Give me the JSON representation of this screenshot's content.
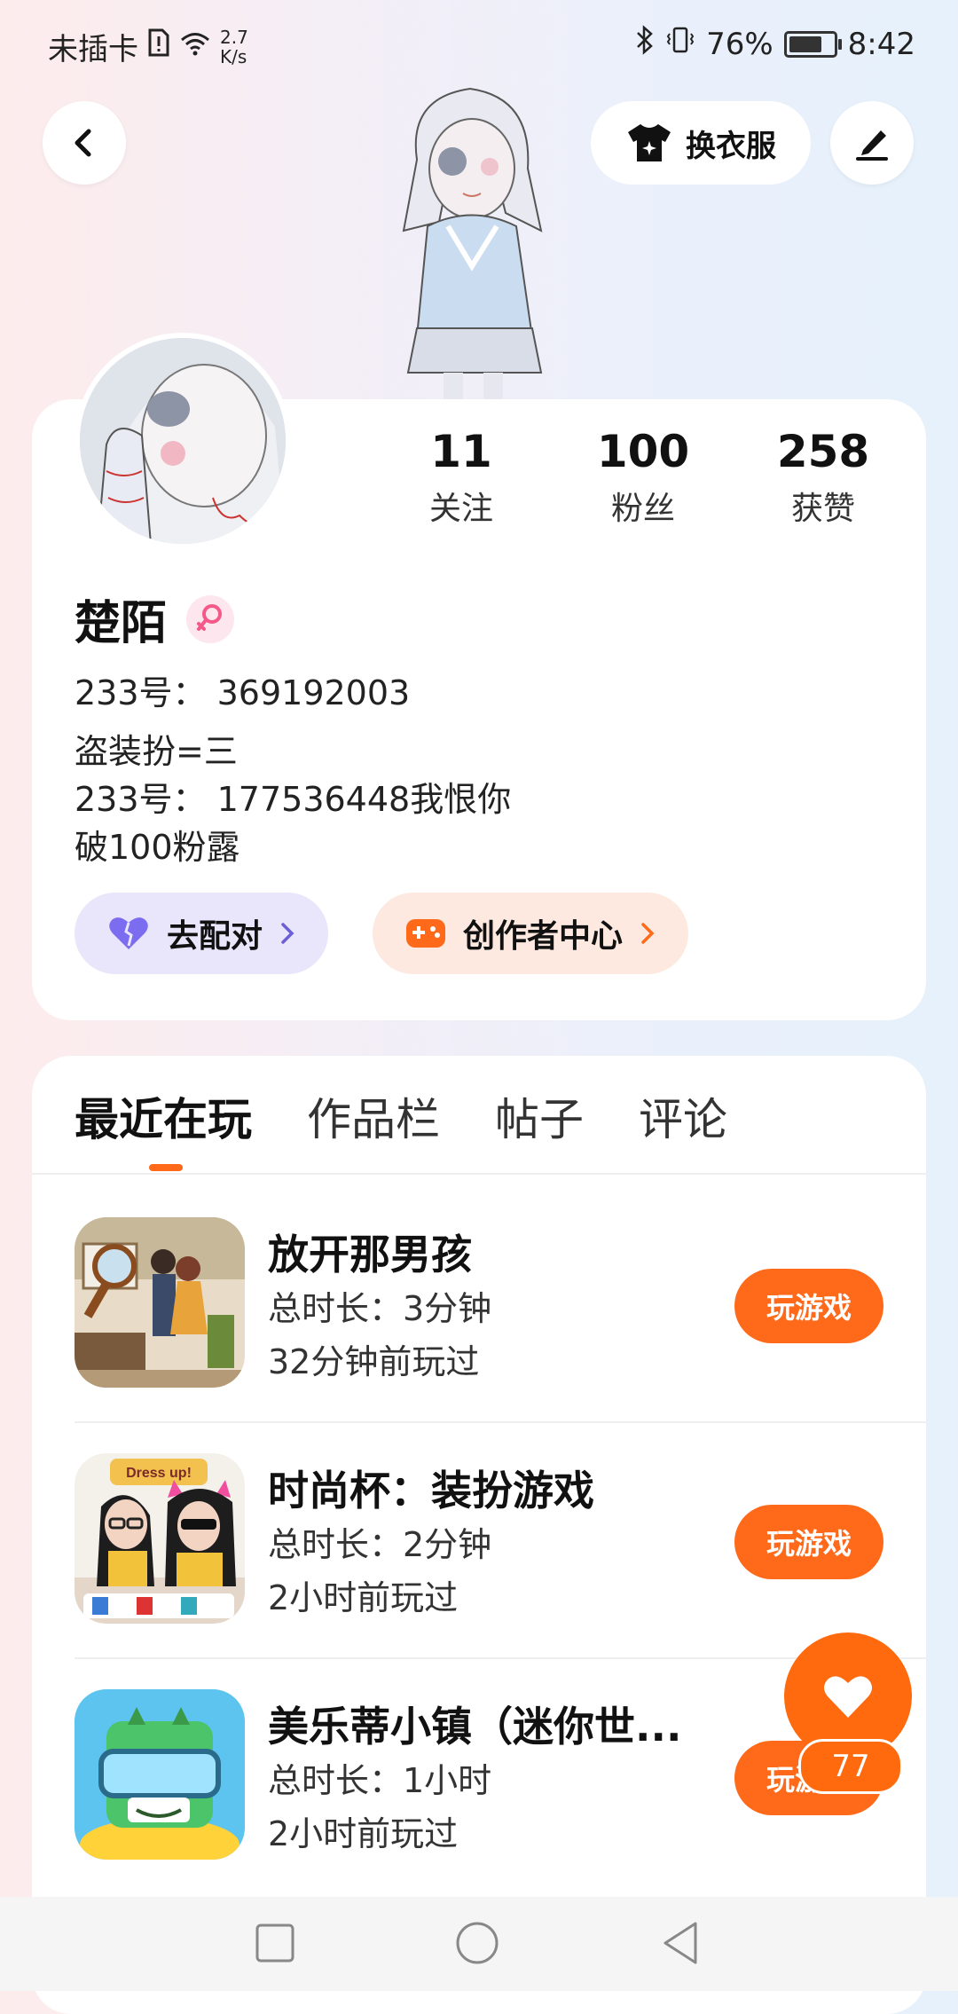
{
  "status_bar": {
    "carrier": "未插卡",
    "speed_value": "2.7",
    "speed_unit": "K/s",
    "battery": "76%",
    "battery_level": 0.76,
    "time": "8:42"
  },
  "header": {
    "change_outfit_label": "换衣服"
  },
  "profile": {
    "stats": [
      {
        "value": "11",
        "label": "关注"
      },
      {
        "value": "100",
        "label": "粉丝"
      },
      {
        "value": "258",
        "label": "获赞"
      }
    ],
    "name": "楚陌",
    "id_line": "233号：  369192003",
    "bio_lines": [
      "盗装扮=三",
      "233号：  177536448我恨你",
      "破100粉露"
    ],
    "match_label": "去配对",
    "creator_label": "创作者中心"
  },
  "tabs": [
    "最近在玩",
    "作品栏",
    "帖子",
    "评论"
  ],
  "games": [
    {
      "title": "放开那男孩",
      "duration": "总时长：3分钟",
      "last_played": "32分钟前玩过",
      "button": "玩游戏"
    },
    {
      "title": "时尚杯：装扮游戏",
      "duration": "总时长：2分钟",
      "last_played": "2小时前玩过",
      "button": "玩游戏",
      "icon_text": "Dress up!"
    },
    {
      "title": "美乐蒂小镇（迷你世...",
      "duration": "总时长：1小时",
      "last_played": "2小时前玩过",
      "button": "玩游戏"
    }
  ],
  "fab": {
    "count": "77"
  },
  "colors": {
    "accent": "#ff6a1a",
    "match_chip_bg": "#e9e6fb",
    "creator_chip_bg": "#fde9e0"
  }
}
